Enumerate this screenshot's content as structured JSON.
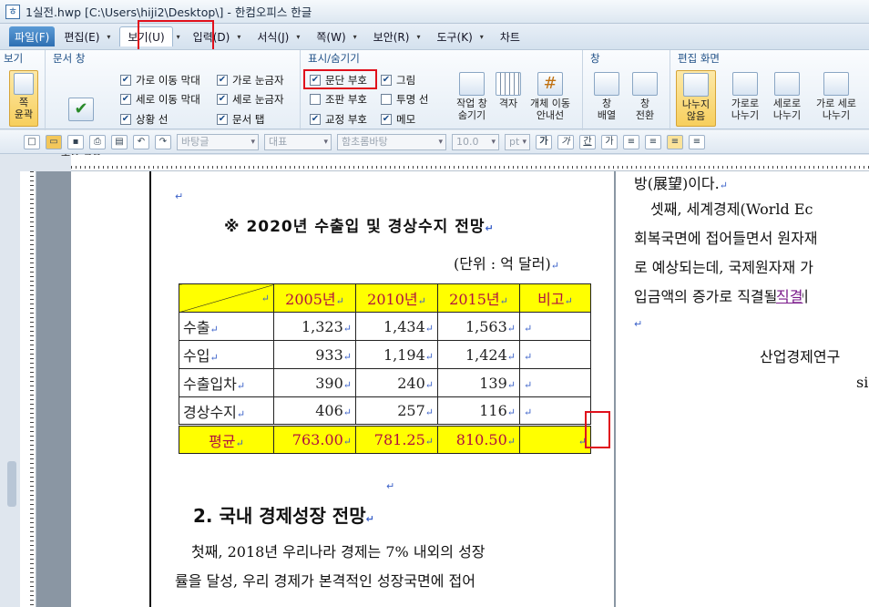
{
  "window": {
    "title": "1실전.hwp [C:\\Users\\hiji2\\Desktop\\] - 한컴오피스 한글"
  },
  "menubar": {
    "items": [
      "파일(F)",
      "편집(E)",
      "보기(U)",
      "입력(D)",
      "서식(J)",
      "쪽(W)",
      "보안(R)",
      "도구(K)",
      "차트"
    ]
  },
  "ribbon": {
    "groups": [
      "보기",
      "문서 창",
      "표시/숨기기",
      "창",
      "편집 화면"
    ],
    "fit_page_label": "쪽\n윤곽",
    "doc_window_style_label": "문서 창\n모양 설정",
    "checks": [
      {
        "label": "가로 이동 막대",
        "checked": true
      },
      {
        "label": "세로 이동 막대",
        "checked": true
      },
      {
        "label": "상황 선",
        "checked": true
      },
      {
        "label": "가로 눈금자",
        "checked": true
      },
      {
        "label": "세로 눈금자",
        "checked": true
      },
      {
        "label": "문서 탭",
        "checked": true
      },
      {
        "label": "문단 부호",
        "checked": true
      },
      {
        "label": "조판 부호",
        "checked": false
      },
      {
        "label": "교정 부호",
        "checked": true
      },
      {
        "label": "그림",
        "checked": true
      },
      {
        "label": "투명 선",
        "checked": false
      },
      {
        "label": "메모",
        "checked": true
      }
    ],
    "buttons": [
      "작업 창\n숨기기",
      "격자",
      "개체 이동\n안내선",
      "창\n배열",
      "창\n전환",
      "나누지\n않음",
      "가로로\n나누기",
      "세로로\n나누기",
      "가로 세로\n나누기"
    ]
  },
  "toolbar": {
    "style": "바탕글",
    "font_type": "대표",
    "font": "함초롬바탕",
    "size": "10.0",
    "unit": "pt"
  },
  "document": {
    "table_title": "※ 2020년 수출입 및 경상수지 전망",
    "unit_note": "(단위 : 억 달러)",
    "table": {
      "headers": [
        "",
        "2005년",
        "2010년",
        "2015년",
        "비고"
      ],
      "rows": [
        [
          "수출",
          "1,323",
          "1,434",
          "1,563",
          ""
        ],
        [
          "수입",
          "933",
          "1,194",
          "1,424",
          ""
        ],
        [
          "수출입차",
          "390",
          "240",
          "139",
          ""
        ],
        [
          "경상수지",
          "406",
          "257",
          "116",
          ""
        ],
        [
          "평균",
          "763.00",
          "781.25",
          "810.50",
          ""
        ]
      ]
    },
    "heading": "2. 국내 경제성장 전망",
    "body_lines": [
      "첫째, 2018년 우리나라 경제는 7% 내외의 성장",
      "률을 달성, 우리 경제가 본격적인 성장국면에 접어"
    ],
    "page2_lines": [
      "방(展望)이다.",
      "셋째, 세계경제(World Ec",
      "회복국면에 접어들면서 원자재",
      "로 예상되는데, 국제원자재 가",
      "입금액의 증가로 직결될 것이"
    ],
    "page2_link_word": "직결",
    "page2_source": "산업경제연구",
    "page2_tail": "si"
  }
}
